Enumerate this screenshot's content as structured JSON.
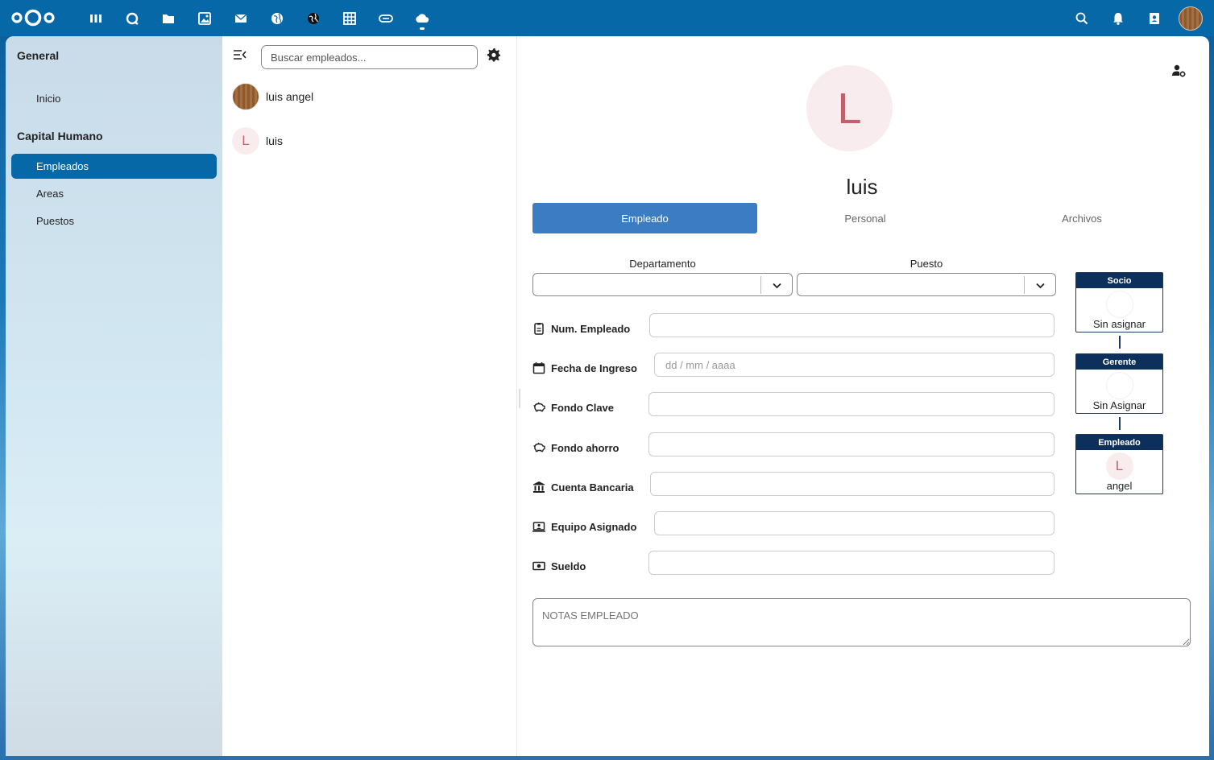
{
  "colors": {
    "primary": "#0768a8",
    "tab_active": "#3b7cc2",
    "org_header": "#0d2f5c",
    "avatar_bg": "#f9ecee",
    "avatar_fg": "#c2616e"
  },
  "topbar": {
    "apps": [
      "dashboard-icon",
      "search-talk-icon",
      "files-icon",
      "photos-icon",
      "mail-icon",
      "globe-icon",
      "world-icon",
      "calendar-grid-icon",
      "link-icon",
      "cloud-icon"
    ],
    "right": [
      "search-icon",
      "bell-icon",
      "contacts-icon",
      "avatar"
    ]
  },
  "nav": {
    "sections": [
      {
        "caption": "General",
        "items": [
          {
            "label": "Inicio"
          }
        ]
      },
      {
        "caption": "Capital Humano",
        "items": [
          {
            "label": "Empleados",
            "active": true
          },
          {
            "label": "Areas"
          },
          {
            "label": "Puestos"
          }
        ]
      }
    ]
  },
  "list": {
    "search_placeholder": "Buscar empleados...",
    "items": [
      {
        "name": "luis angel",
        "avatar": "photo"
      },
      {
        "name": "luis",
        "avatar": "L"
      }
    ]
  },
  "detail": {
    "avatar_letter": "L",
    "name": "luis",
    "tabs": [
      {
        "label": "Empleado",
        "active": true
      },
      {
        "label": "Personal"
      },
      {
        "label": "Archivos"
      }
    ],
    "selects": {
      "departamento_label": "Departamento",
      "departamento_value": "",
      "puesto_label": "Puesto",
      "puesto_value": ""
    },
    "fields": [
      {
        "label": "Num. Empleado",
        "icon": "badge-icon",
        "value": ""
      },
      {
        "label": "Fecha de Ingreso",
        "icon": "calendar-icon",
        "placeholder": "dd / mm / aaaa",
        "value": ""
      },
      {
        "label": "Fondo Clave",
        "icon": "piggy-bank-icon",
        "value": ""
      },
      {
        "label": "Fondo ahorro",
        "icon": "piggy-bank-icon",
        "value": ""
      },
      {
        "label": "Cuenta Bancaria",
        "icon": "bank-icon",
        "value": ""
      },
      {
        "label": "Equipo Asignado",
        "icon": "laptop-icon",
        "value": ""
      },
      {
        "label": "Sueldo",
        "icon": "cash-icon",
        "value": ""
      }
    ],
    "notes_placeholder": "NOTAS EMPLEADO",
    "org": [
      {
        "title": "Socio",
        "name": "Sin asignar",
        "avatar": ""
      },
      {
        "title": "Gerente",
        "name": "Sin Asignar",
        "avatar": ""
      },
      {
        "title": "Empleado",
        "name": "angel",
        "avatar": "L"
      }
    ]
  }
}
